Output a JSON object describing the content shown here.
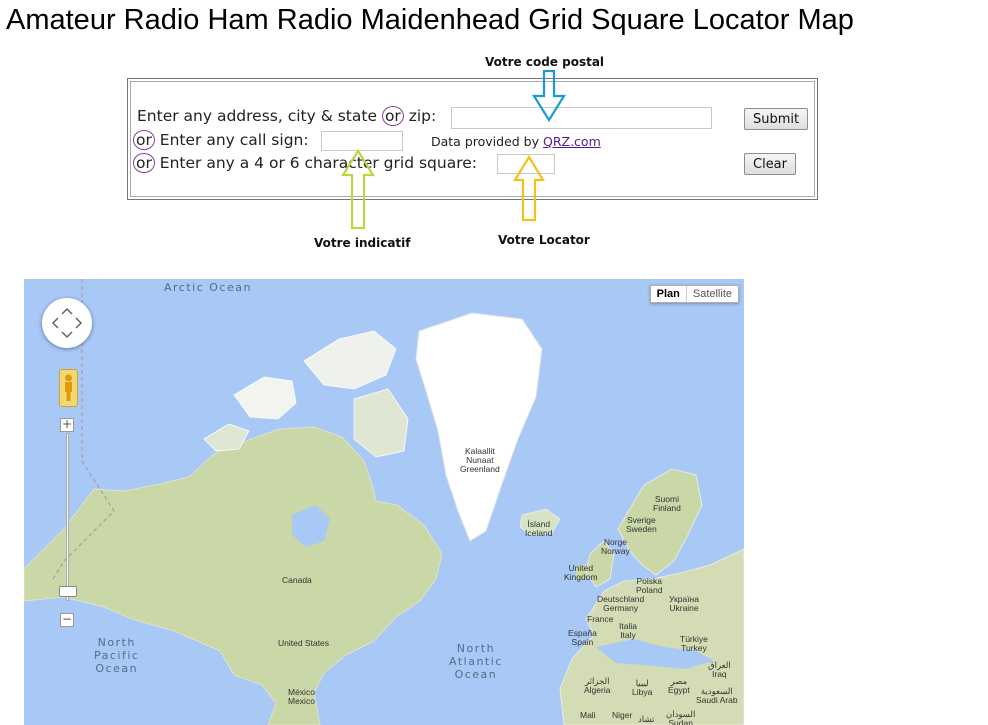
{
  "page": {
    "title": "Amateur Radio Ham Radio Maidenhead Grid Square Locator Map"
  },
  "form": {
    "address_label": "Enter any address, city & state",
    "or_word": "or",
    "zip_label": "zip:",
    "callsign_label": "Enter any call sign:",
    "grid_label": "Enter any a 4 or 6 character grid square:",
    "zip_value": "",
    "callsign_value": "",
    "grid_value": "",
    "provided_text": "Data provided by",
    "provided_link": "QRZ.com",
    "submit_label": "Submit",
    "clear_label": "Clear"
  },
  "annotations": {
    "postal": "Votre code postal",
    "callsign": "Votre indicatif",
    "locator": "Votre Locator",
    "colors": {
      "postal": "#1a9ad6",
      "callsign": "#b8d840",
      "locator": "#f2c21a",
      "circle": "#8a3a9a"
    }
  },
  "map": {
    "type_buttons": {
      "plan": "Plan",
      "satellite": "Satellite"
    },
    "zoom_in": "+",
    "zoom_out": "−",
    "oceans": {
      "arctic": "Arctic Ocean",
      "north_pacific": "North\nPacific\nOcean",
      "north_atlantic": "North\nAtlantic\nOcean"
    },
    "places": {
      "greenland": "Kalaallit\nNunaat\nGreenland",
      "iceland": "Ísland\nIceland",
      "finland": "Suomi\nFinland",
      "sweden": "Sverige\nSweden",
      "norway": "Norge\nNorway",
      "uk": "United\nKingdom",
      "poland": "Polska\nPoland",
      "germany": "Deutschland\nGermany",
      "ukraine": "Україна\nUkraine",
      "france": "France",
      "italy": "Italia\nItaly",
      "spain": "España\nSpain",
      "turkey": "Türkiye\nTurkey",
      "iraq": "العراق\nIraq",
      "saudi": "السعودية\nSaudi Arab",
      "egypt": "مصر\nEgypt",
      "libya": "ليبيا\nLibya",
      "algeria": "الجزائر\nAlgeria",
      "mali": "Mali",
      "niger": "Niger",
      "sudan": "السودان\nSudan",
      "chad": "تشاد",
      "canada": "Canada",
      "usa": "United States",
      "mexico": "México\nMexico"
    }
  }
}
